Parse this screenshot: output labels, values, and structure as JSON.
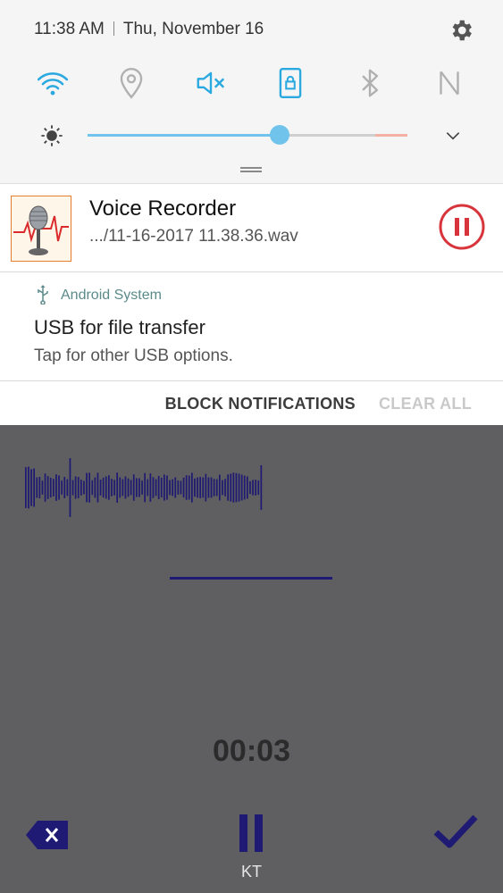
{
  "status_bar": {
    "time": "11:38 AM",
    "date": "Thu, November 16"
  },
  "quick_settings": {
    "toggles": [
      "wifi-icon",
      "location-icon",
      "mute-icon",
      "screen-lock-icon",
      "bluetooth-icon",
      "nfc-icon"
    ],
    "brightness_level": 0.6,
    "colors": {
      "active": "#2aa9e0",
      "inactive": "#b0b0b0",
      "accent": "#70c3ea"
    }
  },
  "notifications": {
    "recorder": {
      "title": "Voice Recorder",
      "file": ".../11-16-2017 11.38.36.wav"
    },
    "usb": {
      "app_name": "Android System",
      "title": "USB for file transfer",
      "subtitle": "Tap for other USB options."
    },
    "actions": {
      "block": "BLOCK NOTIFICATIONS",
      "clear": "CLEAR ALL"
    }
  },
  "recorder": {
    "timer": "00:03",
    "format_label": "KT",
    "colors": {
      "wave": "#1f1a73",
      "pause_icon": "#d8343b"
    }
  }
}
